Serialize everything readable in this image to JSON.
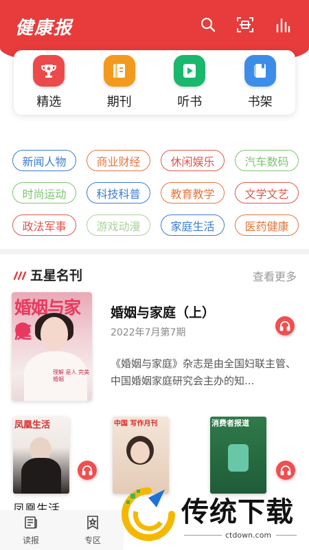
{
  "header": {
    "logo_text": "健康报",
    "icons": [
      "search-icon",
      "scan-icon",
      "audio-bars-icon"
    ],
    "bg_color": "#e83b3b"
  },
  "quick_nav": [
    {
      "label": "精选",
      "icon": "trophy-icon",
      "color": "#ec4a4a"
    },
    {
      "label": "期刊",
      "icon": "journal-icon",
      "color": "#f39a1e"
    },
    {
      "label": "听书",
      "icon": "play-icon",
      "color": "#19b86c"
    },
    {
      "label": "书架",
      "icon": "bookshelf-icon",
      "color": "#3d8de8"
    }
  ],
  "categories": [
    {
      "label": "新闻人物",
      "color": "#3a7bd5"
    },
    {
      "label": "商业财经",
      "color": "#e8743b"
    },
    {
      "label": "休闲娱乐",
      "color": "#e2554a"
    },
    {
      "label": "汽车数码",
      "color": "#7cc46f"
    },
    {
      "label": "时尚运动",
      "color": "#7cc46f"
    },
    {
      "label": "科技科普",
      "color": "#3a7bd5"
    },
    {
      "label": "教育教学",
      "color": "#e8743b"
    },
    {
      "label": "文学文艺",
      "color": "#e2554a"
    },
    {
      "label": "政法军事",
      "color": "#e2554a"
    },
    {
      "label": "游戏动漫",
      "color": "#a8d49a"
    },
    {
      "label": "家庭生活",
      "color": "#3a7bd5"
    },
    {
      "label": "医药健康",
      "color": "#e8743b"
    }
  ],
  "section": {
    "title": "五星名刊",
    "more": "查看更多"
  },
  "featured": {
    "cover_mast": "婚姻与家庭",
    "cover_blurb": "理解 是人 完美婚姻",
    "title": "婚姻与家庭（上）",
    "date": "2022年7月第7期",
    "description": "《婚姻与家庭》杂志是由全国妇联主管、中国婚姻家庭研究会主办的知..."
  },
  "more_items": [
    {
      "title": "凤凰生活",
      "cover_mast": "凤凰生活",
      "mast_color": "#d82c2c"
    },
    {
      "title": "",
      "cover_mast": "中国 写作月刊",
      "mast_color": "#d82c2c"
    },
    {
      "title": "",
      "cover_mast": "消费者报道",
      "mast_color": "#ffffff"
    }
  ],
  "tabbar": [
    {
      "label": "读报",
      "icon": "newspaper-icon"
    },
    {
      "label": "专区",
      "icon": "star-badge-icon"
    }
  ],
  "watermark": {
    "text": "传统下载",
    "url": "ctdown.com"
  }
}
